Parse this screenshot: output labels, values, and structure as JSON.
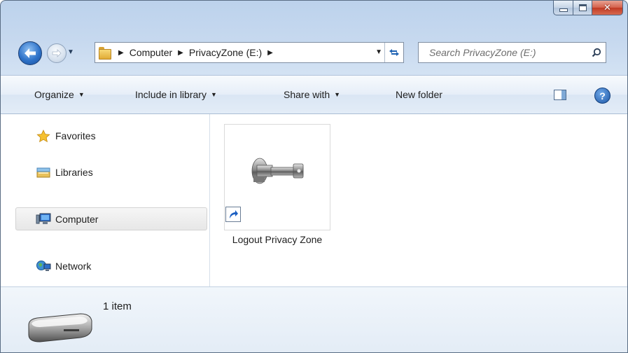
{
  "window": {
    "caption": {
      "minimize_glyph": "minimize-icon",
      "maximize_glyph": "maximize-icon",
      "close_glyph": "✕"
    }
  },
  "navigation": {
    "breadcrumb": [
      "Computer",
      "PrivacyZone (E:)"
    ],
    "search_placeholder": "Search PrivacyZone (E:)"
  },
  "commandbar": {
    "organize": "Organize",
    "include_in_library": "Include in library",
    "share_with": "Share with",
    "new_folder": "New folder",
    "help": "?"
  },
  "navpane": {
    "items": [
      {
        "label": "Favorites",
        "icon": "star-icon"
      },
      {
        "label": "Libraries",
        "icon": "library-icon"
      },
      {
        "label": "Computer",
        "icon": "computer-icon",
        "selected": true
      },
      {
        "label": "Network",
        "icon": "network-icon"
      }
    ]
  },
  "files": [
    {
      "name": "Logout Privacy Zone",
      "icon": "key-icon",
      "shortcut": true
    }
  ],
  "details": {
    "item_count": "1 item"
  },
  "colors": {
    "accent": "#1f63b3",
    "close": "#c13b24",
    "frame": "#bcd2ec"
  }
}
